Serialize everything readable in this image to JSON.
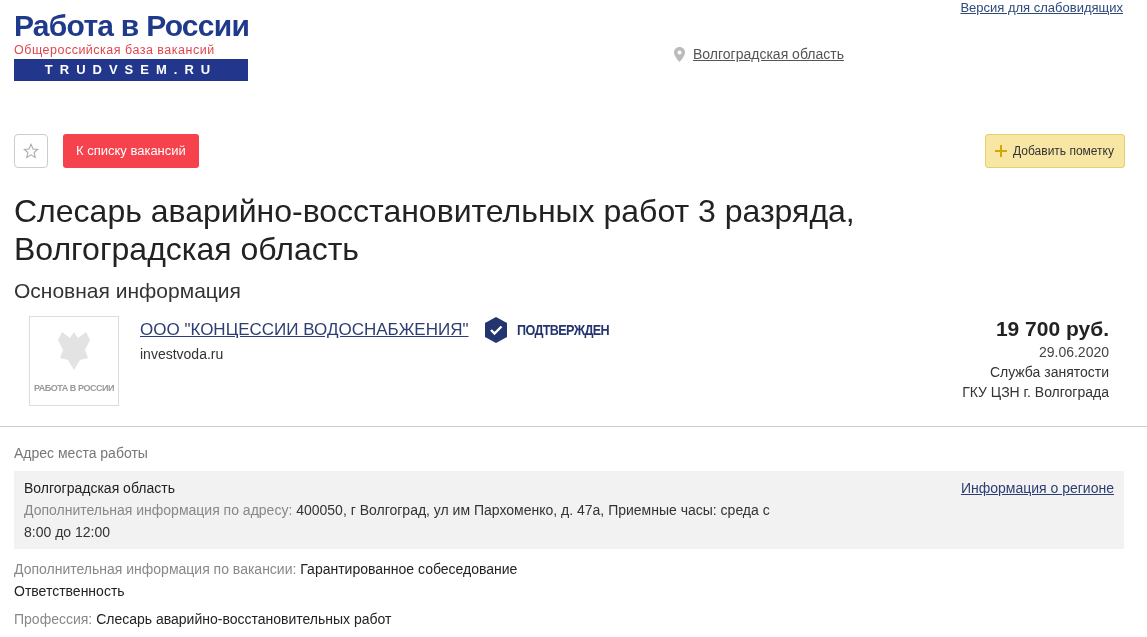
{
  "header": {
    "logo": {
      "title": "Работа в России",
      "subtitle": "Общероссийская база вакансий",
      "domain": "TRUDVSEM.RU"
    },
    "region": "Волгоградская область",
    "accessibility_link": "Версия для слабовидящих"
  },
  "toolbar": {
    "favorite": false,
    "back_button": "К списку вакансий",
    "note_button": "Добавить пометку"
  },
  "vacancy": {
    "title": "Слесарь аварийно-восстановительных работ 3 разряда, Волгоградская область",
    "section": "Основная информация",
    "company": {
      "logo_caption": "РАБОТА В РОССИИ",
      "name": "ООО \"КОНЦЕССИИ ВОДОСНАБЖЕНИЯ\"",
      "verified": true,
      "badge": "ПОДТВЕРЖДЕН",
      "site": "investvoda.ru"
    },
    "salary": "19 700 руб.",
    "date": "29.06.2020",
    "source": [
      "Служба занятости",
      "ГКУ ЦЗН г. Волгограда"
    ]
  },
  "address": {
    "heading": "Адрес места работы",
    "region": "Волгоградская область",
    "extra_label": "Дополнительная информация по адресу:",
    "extra_value": "400050, г Волгоград, ул им Пархоменко, д. 47а, Приемные часы: среда с 8:00 до 12:00",
    "region_link": "Информация о регионе"
  },
  "details": [
    {
      "label": "Дополнительная информация по вакансии:",
      "value": "Гарантированное собеседование Ответственность"
    },
    {
      "label": "Профессия:",
      "value": "Слесарь аварийно-восстановительных работ"
    }
  ]
}
